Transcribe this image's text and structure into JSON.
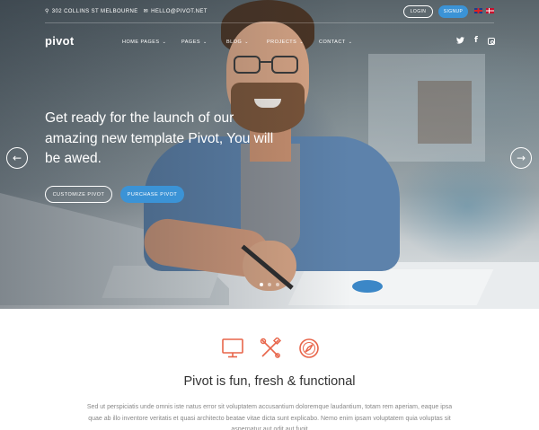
{
  "topbar": {
    "address": "302 COLLINS ST MELBOURNE",
    "email": "HELLO@PIVOT.NET",
    "login_label": "LOGIN",
    "signup_label": "SIGNUP",
    "flags": [
      "uk-flag",
      "denmark-flag"
    ]
  },
  "nav": {
    "logo": "pivot",
    "items": [
      {
        "label": "HOME PAGES"
      },
      {
        "label": "PAGES"
      },
      {
        "label": "BLOG"
      },
      {
        "label": "PROJECTS"
      },
      {
        "label": "CONTACT"
      }
    ],
    "social": [
      "twitter-icon",
      "facebook-icon",
      "instagram-icon"
    ]
  },
  "hero": {
    "headline": "Get ready for the launch of our amazing new template Pivot, You will be awed.",
    "primary_cta": "CUSTOMIZE PIVOT",
    "secondary_cta": "PURCHASE PIVOT",
    "slides": 3,
    "active_slide": 1
  },
  "features": {
    "icons": [
      "monitor-icon",
      "tools-icon",
      "compass-icon"
    ],
    "title": "Pivot is fun, fresh & functional",
    "body": "Sed ut perspiciatis unde omnis iste natus error sit voluptatem accusantium doloremque laudantium, totam rem aperiam, eaque ipsa quae ab illo inventore veritatis et quasi architecto beatae vitae dicta sunt explicabo. Nemo enim ipsam voluptatem quia voluptas sit aspernatur aut odit aut fugit"
  },
  "colors": {
    "accent": "#3b93d6",
    "feature_icon": "#e8654a"
  }
}
